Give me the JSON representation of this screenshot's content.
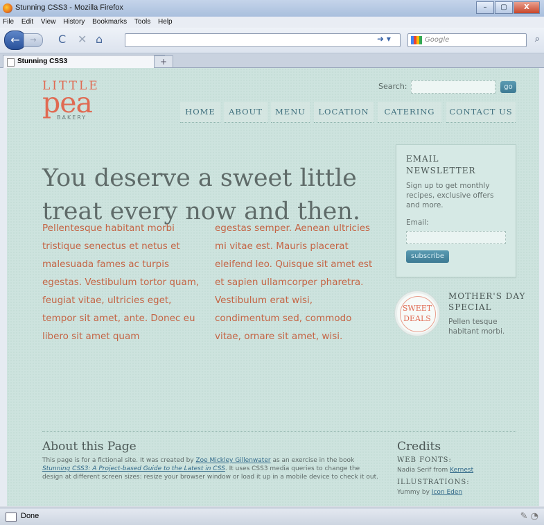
{
  "window": {
    "title": "Stunning CSS3 - Mozilla Firefox",
    "buttons": [
      "–",
      "▢",
      "X"
    ]
  },
  "menubar": [
    "File",
    "Edit",
    "View",
    "History",
    "Bookmarks",
    "Tools",
    "Help"
  ],
  "toolbar": {
    "back_icon": "back-arrow-icon",
    "reload": "C",
    "stop": "✕",
    "home": "⌂",
    "url": "",
    "search_placeholder": "Google"
  },
  "tab": {
    "label": "Stunning CSS3",
    "new_tab": "+"
  },
  "site": {
    "logo": {
      "line1": "LITTLE",
      "line2": "pea",
      "line3": "BAKERY"
    },
    "search": {
      "label": "Search:",
      "value": "",
      "button": "go"
    },
    "nav": [
      "HOME",
      "ABOUT",
      "MENU",
      "LOCATION",
      "CATERING",
      "CONTACT US"
    ],
    "headline": "You deserve a sweet little treat every now and then.",
    "body_left": "Pellentesque habitant morbi tristique senectus et netus et malesuada fames ac turpis egestas. Vestibulum tortor quam, feugiat vitae, ultricies eget, tempor sit amet, ante. Donec eu libero sit amet quam",
    "body_right": "egestas semper. Aenean ultricies mi vitae est. Mauris placerat eleifend leo. Quisque sit amet est et sapien ullamcorper pharetra. Vestibulum erat wisi, condimentum sed, commodo vitae, ornare sit amet, wisi.",
    "newsletter": {
      "title": "EMAIL NEWSLETTER",
      "description": "Sign up to get monthly recipes, exclusive offers and more.",
      "email_label": "Email:",
      "email_value": "",
      "button": "subscribe"
    },
    "badge": {
      "line1": "SWEET",
      "line2": "DEALS"
    },
    "special": {
      "title": "MOTHER'S DAY SPECIAL",
      "description": "Pellen tesque habitant morbi."
    },
    "about": {
      "title": "About this Page",
      "text_before_author": "This page is for a fictional site. It was created by ",
      "author": "Zoe Mickley Gillenwater",
      "text_after_author": " as an exercise in the book ",
      "book": "Stunning CSS3: A Project-based Guide to the Latest in CSS",
      "text_end": ". It uses CSS3 media queries to change the design at different screen sizes: resize your browser window or load it up in a mobile device to check it out."
    },
    "credits": {
      "title": "Credits",
      "web_fonts_head": "WEB FONTS:",
      "web_fonts_text": "Nadia Serif from ",
      "web_fonts_link": "Kernest",
      "illustrations_head": "ILLUSTRATIONS:",
      "illustrations_text": "Yummy by ",
      "illustrations_link": "Icon Eden"
    }
  },
  "status": {
    "text": "Done"
  },
  "colors": {
    "accent": "#e06a52",
    "nav": "#3f6f7d",
    "background": "#cde3de",
    "body_text": "#c46545"
  }
}
